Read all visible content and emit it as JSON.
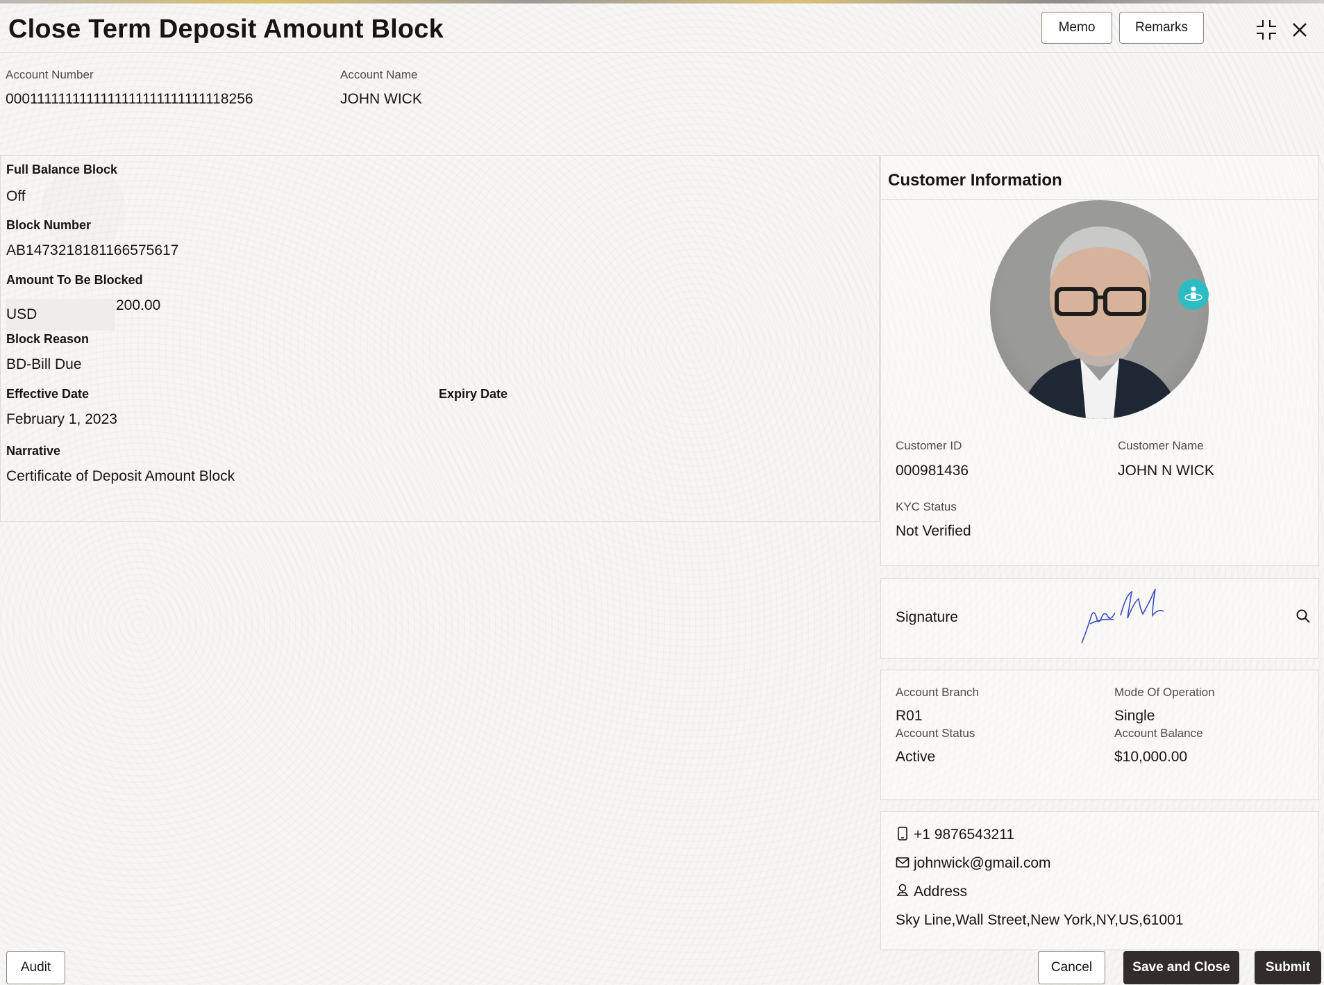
{
  "page": {
    "title": "Close Term Deposit Amount Block"
  },
  "header": {
    "memo_label": "Memo",
    "remarks_label": "Remarks"
  },
  "account": {
    "number_label": "Account Number",
    "number": "0001111111111111111111111111118256",
    "name_label": "Account Name",
    "name": "JOHN WICK"
  },
  "block": {
    "full_balance_label": "Full Balance Block",
    "full_balance": "Off",
    "number_label": "Block Number",
    "number": "AB1473218181166575617",
    "amount_label": "Amount To Be Blocked",
    "currency": "USD",
    "amount": "200.00",
    "reason_label": "Block Reason",
    "reason": "BD-Bill Due",
    "effective_label": "Effective Date",
    "effective": "February 1, 2023",
    "expiry_label": "Expiry Date",
    "narrative_label": "Narrative",
    "narrative": "Certificate of Deposit Amount Block"
  },
  "customer": {
    "heading": "Customer Information",
    "id_label": "Customer ID",
    "id": "000981436",
    "name_label": "Customer Name",
    "name": "JOHN N WICK",
    "kyc_label": "KYC Status",
    "kyc": "Not Verified",
    "signature_label": "Signature"
  },
  "account_info": {
    "branch_label": "Account Branch",
    "branch": "R01",
    "mode_label": "Mode Of Operation",
    "mode": "Single",
    "status_label": "Account Status",
    "status": "Active",
    "balance_label": "Account Balance",
    "balance": "$10,000.00"
  },
  "contact": {
    "phone": "+1 9876543211",
    "email": "johnwick@gmail.com",
    "address_label": "Address",
    "address": "Sky Line,Wall Street,New York,NY,US,61001"
  },
  "footer": {
    "audit_label": "Audit",
    "cancel_label": "Cancel",
    "save_close_label": "Save and Close",
    "submit_label": "Submit"
  }
}
